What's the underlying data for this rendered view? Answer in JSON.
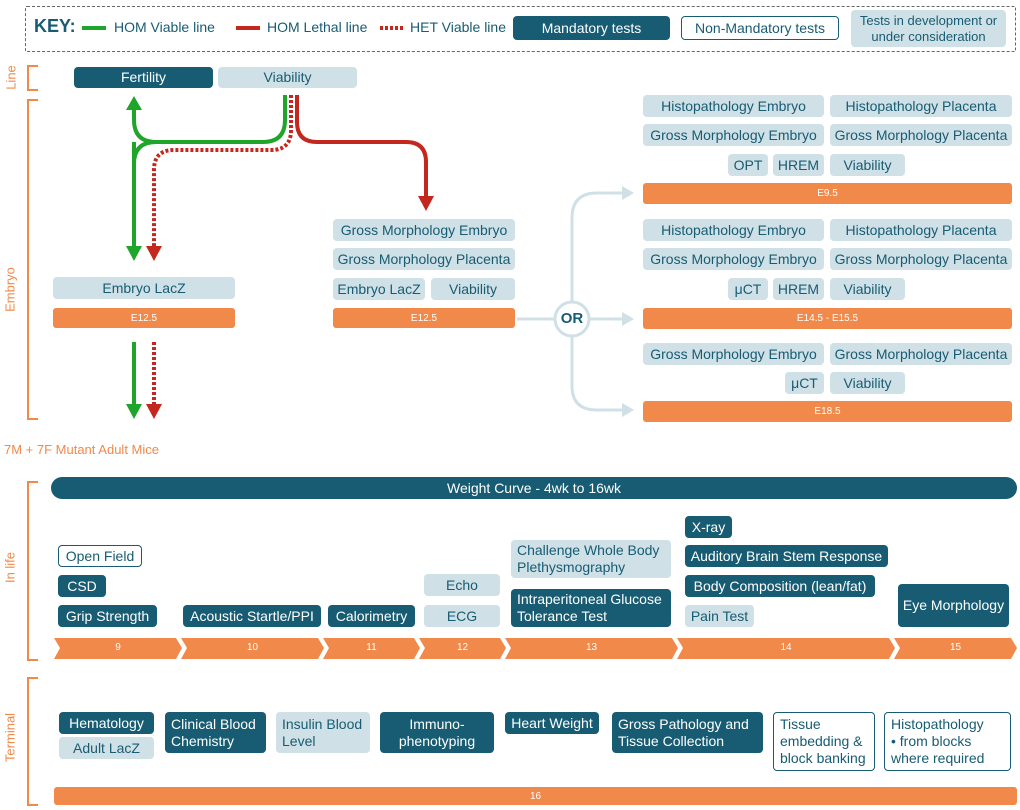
{
  "key": {
    "title": "KEY:",
    "hom_viable": "HOM Viable line",
    "hom_lethal": "HOM Lethal line",
    "het_viable": "HET Viable line",
    "mandatory": "Mandatory tests",
    "non_mandatory": "Non-Mandatory tests",
    "in_development": "Tests in development or under consideration"
  },
  "sections": {
    "line": "Line",
    "embryo": "Embryo",
    "in_life": "In life",
    "terminal": "Terminal"
  },
  "line_row": {
    "fertility": "Fertility",
    "viability": "Viability"
  },
  "embryo": {
    "left": {
      "lacz": "Embryo LacZ",
      "stage": "E12.5"
    },
    "middle": {
      "gross_embryo": "Gross Morphology Embryo",
      "gross_placenta": "Gross Morphology Placenta",
      "lacz": "Embryo LacZ",
      "viability": "Viability",
      "stage": "E12.5"
    },
    "or_label": "OR",
    "e95": {
      "histo_embryo": "Histopathology Embryo",
      "histo_placenta": "Histopathology Placenta",
      "gross_embryo": "Gross Morphology Embryo",
      "gross_placenta": "Gross Morphology Placenta",
      "opt": "OPT",
      "hrem": "HREM",
      "viability": "Viability",
      "stage": "E9.5"
    },
    "e145": {
      "histo_embryo": "Histopathology Embryo",
      "histo_placenta": "Histopathology Placenta",
      "gross_embryo": "Gross Morphology Embryo",
      "gross_placenta": "Gross Morphology Placenta",
      "uct": "μCT",
      "hrem": "HREM",
      "viability": "Viability",
      "stage": "E14.5 - E15.5"
    },
    "e185": {
      "gross_embryo": "Gross Morphology Embryo",
      "gross_placenta": "Gross Morphology Placenta",
      "uct": "μCT",
      "viability": "Viability",
      "stage": "E18.5"
    },
    "adult_mice": "7M + 7F Mutant Adult Mice"
  },
  "in_life": {
    "weight_curve": "Weight Curve - 4wk to 16wk",
    "open_field": "Open Field",
    "csd": "CSD",
    "grip": "Grip Strength",
    "acoustic": "Acoustic Startle/PPI",
    "calorimetry": "Calorimetry",
    "echo": "Echo",
    "ecg": "ECG",
    "challenge": "Challenge Whole Body Plethysmography",
    "ipgtt": "Intraperitoneal Glucose Tolerance Test",
    "xray": "X-ray",
    "abr": "Auditory Brain Stem Response",
    "body_comp": "Body Composition (lean/fat)",
    "pain": "Pain Test",
    "eye": "Eye Morphology",
    "weeks": [
      "9",
      "10",
      "11",
      "12",
      "13",
      "14",
      "15"
    ]
  },
  "terminal": {
    "hematology": "Hematology",
    "adult_lacz": "Adult LacZ",
    "clinical_blood": "Clinical Blood Chemistry",
    "insulin": "Insulin Blood Level",
    "immuno": "Immuno-phenotyping",
    "heart_weight": "Heart Weight",
    "gross_path": "Gross Pathology and Tissue Collection",
    "tissue_embed": "Tissue embedding & block banking",
    "histopath_title": "Histopathology",
    "histopath_note": "• from blocks where required",
    "week": "16"
  },
  "colors": {
    "mandatory": "#175c73",
    "development": "#cfe0e6",
    "orange": "#f0894a",
    "green": "#1fa52a",
    "red": "#c4271e",
    "connector": "#cfe0e6"
  }
}
